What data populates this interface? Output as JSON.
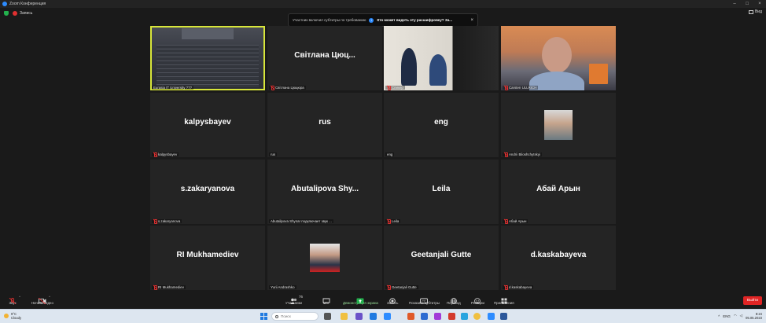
{
  "window": {
    "title": "Zoom Конференция"
  },
  "topbar": {
    "recording_label": "Запись",
    "view_label": "Вид"
  },
  "notification": {
    "line1": "Участник включил субтитры по требованию",
    "line2": "Кто может видеть эту расшифровку? За..."
  },
  "tiles": [
    {
      "label": "Eurasia IT University ???",
      "big": "",
      "kind": "auditorium",
      "active": true,
      "muted": false
    },
    {
      "label": "Світлана Цюцюра",
      "big": "Світлана Цюц...",
      "kind": "name",
      "muted": true
    },
    {
      "label": "Спикер",
      "big": "",
      "kind": "conference",
      "muted": true
    },
    {
      "label": "Carsten ULLRICH",
      "big": "",
      "kind": "city",
      "muted": true
    },
    {
      "label": "kalpysbayev",
      "big": "kalpysbayev",
      "kind": "name",
      "muted": true
    },
    {
      "label": "rus",
      "big": "rus",
      "kind": "name",
      "muted": false
    },
    {
      "label": "eng",
      "big": "eng",
      "kind": "name",
      "muted": false
    },
    {
      "label": "Andrii Biloshchytskyi",
      "big": "",
      "kind": "headshot",
      "muted": true
    },
    {
      "label": "s.zakaryanova",
      "big": "s.zakaryanova",
      "kind": "name",
      "muted": true
    },
    {
      "label": "Abutalipova Shynar подключает звук ...",
      "big": "Abutalipova  Shy...",
      "kind": "name",
      "muted": false
    },
    {
      "label": "Leila",
      "big": "Leila",
      "kind": "name",
      "muted": true
    },
    {
      "label": "Абай Арын",
      "big": "Абай Арын",
      "kind": "name",
      "muted": true
    },
    {
      "label": "RI Mukhamediev",
      "big": "RI Mukhamediev",
      "kind": "name",
      "muted": true
    },
    {
      "label": "Yurii Andrashko",
      "big": "",
      "kind": "headshot2",
      "muted": false
    },
    {
      "label": "Geetanjali Gutte",
      "big": "Geetanjali Gutte",
      "kind": "name",
      "muted": true
    },
    {
      "label": "d.kaskabayeva",
      "big": "d.kaskabayeva",
      "kind": "name",
      "muted": true
    }
  ],
  "toolbar": {
    "audio": "Звук",
    "video": "Начать видео",
    "participants": "Участники",
    "participants_count": "76",
    "chat": "Чат",
    "share": "Демонстрация экрана",
    "record": "Запись",
    "captions": "Показать субтитры",
    "translate": "Перевод",
    "reactions": "Реакции",
    "apps": "Приложения",
    "leave": "Выйти"
  },
  "taskbar": {
    "temperature": "9°C",
    "weather": "Cloudy",
    "search_placeholder": "Поиск",
    "language": "ENG",
    "time": "8:24",
    "date": "05.05.2023"
  },
  "colors": {
    "accent": "#2d8cff",
    "leave": "#e02424",
    "active_speaker": "#d8e63a",
    "muted": "#e03030"
  }
}
